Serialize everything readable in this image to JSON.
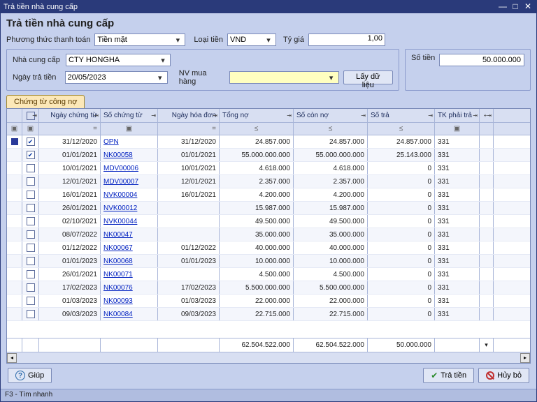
{
  "window_title": "Trả tiền nhà cung cấp",
  "page_title": "Trả tiền nhà cung cấp",
  "form": {
    "payment_method_label": "Phương thức thanh toán",
    "payment_method_value": "Tiền mặt",
    "currency_label": "Loại tiền",
    "currency_value": "VND",
    "rate_label": "Tỷ giá",
    "rate_value": "1,00",
    "supplier_label": "Nhà cung cấp",
    "supplier_value": "CTY HONGHA",
    "pay_date_label": "Ngày trả tiền",
    "pay_date_value": "20/05/2023",
    "purchaser_label": "NV mua hàng",
    "purchaser_value": "",
    "fetch_btn": "Lấy dữ liệu",
    "amount_label": "Số tiền",
    "amount_value": "50.000.000"
  },
  "tab": {
    "debt_docs": "Chứng từ công nợ"
  },
  "columns": {
    "c2": "Ngày chứng từ",
    "c3": "Số chứng từ",
    "c4": "Ngày hóa đơn",
    "c5": "Tổng nợ",
    "c6": "Số còn nợ",
    "c7": "Số trả",
    "c8": "TK phải trả"
  },
  "filter_ops": {
    "eq": "=",
    "le": "≤",
    "sq": "▣"
  },
  "rows": [
    {
      "sel": true,
      "chk": true,
      "date": "31/12/2020",
      "doc": "OPN",
      "inv": "31/12/2020",
      "debt": "24.857.000",
      "remain": "24.857.000",
      "pay": "24.857.000",
      "acc": "331"
    },
    {
      "sel": false,
      "chk": true,
      "date": "01/01/2021",
      "doc": "NK00058",
      "inv": "01/01/2021",
      "debt": "55.000.000.000",
      "remain": "55.000.000.000",
      "pay": "25.143.000",
      "acc": "331"
    },
    {
      "sel": false,
      "chk": false,
      "date": "10/01/2021",
      "doc": "MDV00006",
      "inv": "10/01/2021",
      "debt": "4.618.000",
      "remain": "4.618.000",
      "pay": "0",
      "acc": "331"
    },
    {
      "sel": false,
      "chk": false,
      "date": "12/01/2021",
      "doc": "MDV00007",
      "inv": "12/01/2021",
      "debt": "2.357.000",
      "remain": "2.357.000",
      "pay": "0",
      "acc": "331"
    },
    {
      "sel": false,
      "chk": false,
      "date": "16/01/2021",
      "doc": "NVK00004",
      "inv": "16/01/2021",
      "debt": "4.200.000",
      "remain": "4.200.000",
      "pay": "0",
      "acc": "331"
    },
    {
      "sel": false,
      "chk": false,
      "date": "26/01/2021",
      "doc": "NVK00012",
      "inv": "",
      "debt": "15.987.000",
      "remain": "15.987.000",
      "pay": "0",
      "acc": "331"
    },
    {
      "sel": false,
      "chk": false,
      "date": "02/10/2021",
      "doc": "NVK00044",
      "inv": "",
      "debt": "49.500.000",
      "remain": "49.500.000",
      "pay": "0",
      "acc": "331"
    },
    {
      "sel": false,
      "chk": false,
      "date": "08/07/2022",
      "doc": "NK00047",
      "inv": "",
      "debt": "35.000.000",
      "remain": "35.000.000",
      "pay": "0",
      "acc": "331"
    },
    {
      "sel": false,
      "chk": false,
      "date": "01/12/2022",
      "doc": "NK00067",
      "inv": "01/12/2022",
      "debt": "40.000.000",
      "remain": "40.000.000",
      "pay": "0",
      "acc": "331"
    },
    {
      "sel": false,
      "chk": false,
      "date": "01/01/2023",
      "doc": "NK00068",
      "inv": "01/01/2023",
      "debt": "10.000.000",
      "remain": "10.000.000",
      "pay": "0",
      "acc": "331"
    },
    {
      "sel": false,
      "chk": false,
      "date": "26/01/2021",
      "doc": "NK00071",
      "inv": "",
      "debt": "4.500.000",
      "remain": "4.500.000",
      "pay": "0",
      "acc": "331"
    },
    {
      "sel": false,
      "chk": false,
      "date": "17/02/2023",
      "doc": "NK00076",
      "inv": "17/02/2023",
      "debt": "5.500.000.000",
      "remain": "5.500.000.000",
      "pay": "0",
      "acc": "331"
    },
    {
      "sel": false,
      "chk": false,
      "date": "01/03/2023",
      "doc": "NK00093",
      "inv": "01/03/2023",
      "debt": "22.000.000",
      "remain": "22.000.000",
      "pay": "0",
      "acc": "331"
    },
    {
      "sel": false,
      "chk": false,
      "date": "09/03/2023",
      "doc": "NK00084",
      "inv": "09/03/2023",
      "debt": "22.715.000",
      "remain": "22.715.000",
      "pay": "0",
      "acc": "331"
    }
  ],
  "totals": {
    "debt": "62.504.522.000",
    "remain": "62.504.522.000",
    "pay": "50.000.000"
  },
  "buttons": {
    "help": "Giúp",
    "pay": "Trả tiền",
    "cancel": "Hủy bỏ"
  },
  "statusbar": "F3 - Tìm nhanh"
}
